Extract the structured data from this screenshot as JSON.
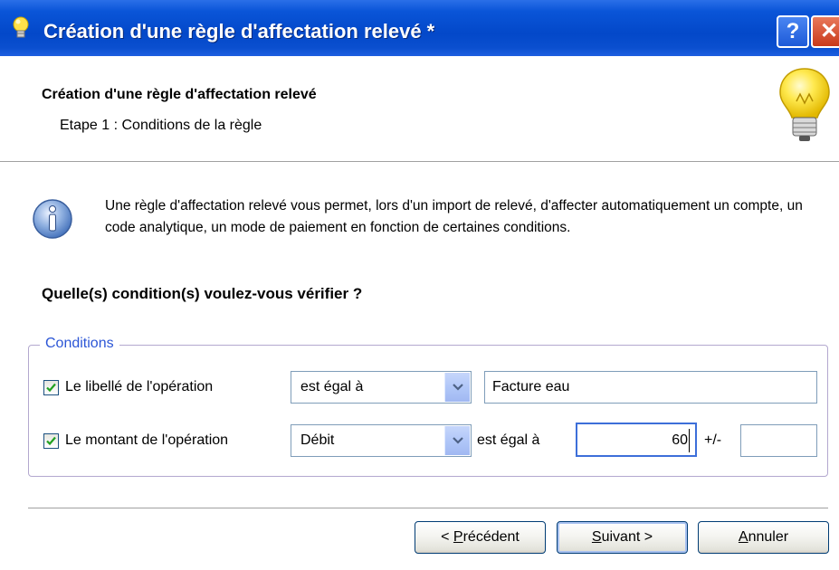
{
  "window": {
    "title": "Création d'une règle d'affectation relevé *",
    "help_label": "?",
    "close_label": "✕"
  },
  "header": {
    "title": "Création d'une règle d'affectation relevé",
    "step": "Etape 1 : Conditions de la règle"
  },
  "info": {
    "text": "Une règle d'affectation relevé vous permet, lors d'un import de relevé, d'affecter automatiquement un compte, un code analytique, un mode de paiement en fonction de certaines conditions."
  },
  "question": "Quelle(s) condition(s) voulez-vous vérifier ?",
  "conditions": {
    "legend": "Conditions",
    "row1": {
      "checked": true,
      "label": "Le libellé de l'opération",
      "operator": "est égal à",
      "value": "Facture eau"
    },
    "row2": {
      "checked": true,
      "label": "Le montant de l'opération",
      "type": "Débit",
      "operator_label": "est égal à",
      "amount": "60",
      "tolerance_label": "+/-",
      "tolerance": ""
    }
  },
  "buttons": {
    "previous_prefix": "< ",
    "previous_underlined": "P",
    "previous_rest": "récédent",
    "next_underlined": "S",
    "next_rest": "uivant >",
    "cancel_underlined": "A",
    "cancel_rest": "nnuler"
  },
  "colors": {
    "titlebar": "#0348c9",
    "group_legend": "#2c56d6",
    "group_border": "#b3a8cf",
    "checkmark": "#21a121"
  },
  "icons": {
    "window": "lightbulb-icon",
    "header": "lightbulb-icon",
    "info": "info-icon",
    "checkbox": "checkmark-icon",
    "combo": "chevron-down-icon"
  }
}
